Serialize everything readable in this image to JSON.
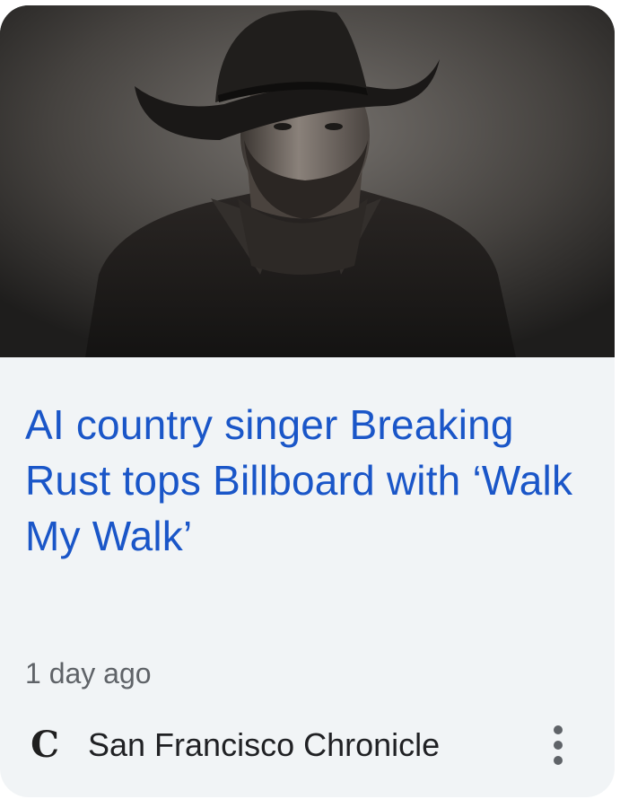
{
  "card": {
    "image_description_icon": "portrait-photo",
    "title": "AI country singer Breaking Rust tops Billboard with ‘Walk My Walk’",
    "time_ago": "1 day ago",
    "source": {
      "name": "San Francisco Chronicle",
      "logo_glyph": "C",
      "logo_icon": "san-francisco-chronicle-logo"
    },
    "more_icon": "more-vertical-icon"
  },
  "colors": {
    "title": "#1a56c8",
    "meta": "#5f6368",
    "card_bg": "#f1f4f6"
  }
}
